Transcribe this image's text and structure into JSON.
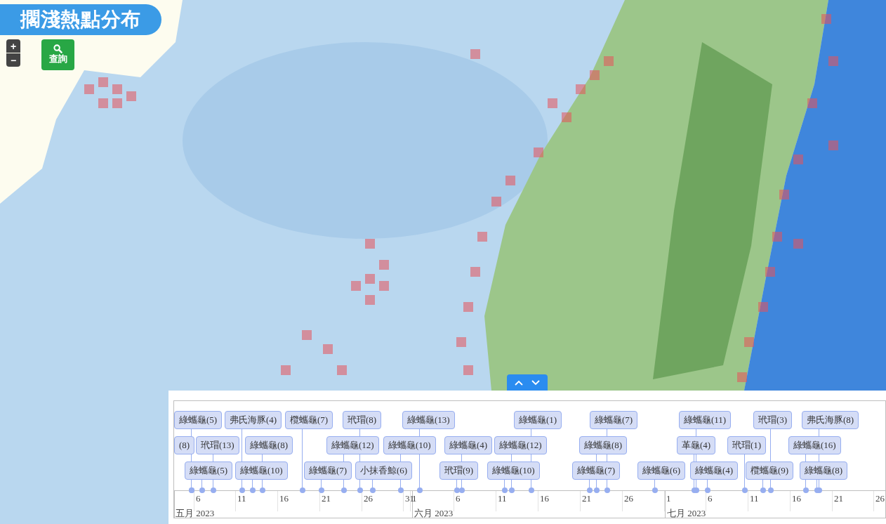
{
  "title": "擱淺熱點分布",
  "map_controls": {
    "zoom_in": "+",
    "zoom_out": "−"
  },
  "search_button": {
    "label": "查詢"
  },
  "timeline": {
    "lanes": [
      {
        "events": [
          {
            "label": "綠蠵龜(5)"
          },
          {
            "label": "弗氏海豚(4)"
          },
          {
            "label": "欖蠵龜(7)"
          },
          {
            "label": "玳瑁(8)"
          },
          {
            "label": "綠蠵龜(13)"
          },
          {
            "label": "綠蠵龜(1)"
          },
          {
            "label": "綠蠵龜(7)"
          },
          {
            "label": "綠蠵龜(11)"
          },
          {
            "label": "玳瑁(3)"
          },
          {
            "label": "弗氏海豚(8)"
          }
        ]
      },
      {
        "events": [
          {
            "label": "(8)"
          },
          {
            "label": "玳瑁(13)"
          },
          {
            "label": "綠蠵龜(8)"
          },
          {
            "label": "綠蠵龜(12)"
          },
          {
            "label": "綠蠵龜(10)"
          },
          {
            "label": "綠蠵龜(4)"
          },
          {
            "label": "綠蠵龜(12)"
          },
          {
            "label": "綠蠵龜(8)"
          },
          {
            "label": "革龜(4)"
          },
          {
            "label": "玳瑁(1)"
          },
          {
            "label": "綠蠵龜(16)"
          }
        ]
      },
      {
        "events": [
          {
            "label": "綠蠵龜(5)"
          },
          {
            "label": "綠蠵龜(10)"
          },
          {
            "label": "綠蠵龜(7)"
          },
          {
            "label": "小抹香鯨(6)"
          },
          {
            "label": "玳瑁(9)"
          },
          {
            "label": "綠蠵龜(10)"
          },
          {
            "label": "綠蠵龜(7)"
          },
          {
            "label": "綠蠵龜(6)"
          },
          {
            "label": "綠蠵龜(4)"
          },
          {
            "label": "欖蠵龜(9)"
          },
          {
            "label": "綠蠵龜(8)"
          }
        ]
      }
    ],
    "ticks": [
      "6",
      "11",
      "16",
      "21",
      "26",
      "31",
      "1",
      "6",
      "11",
      "16",
      "21",
      "26",
      "1",
      "6",
      "11",
      "16",
      "21",
      "26"
    ],
    "months": [
      "五月 2023",
      "六月 2023",
      "七月 2023"
    ]
  }
}
